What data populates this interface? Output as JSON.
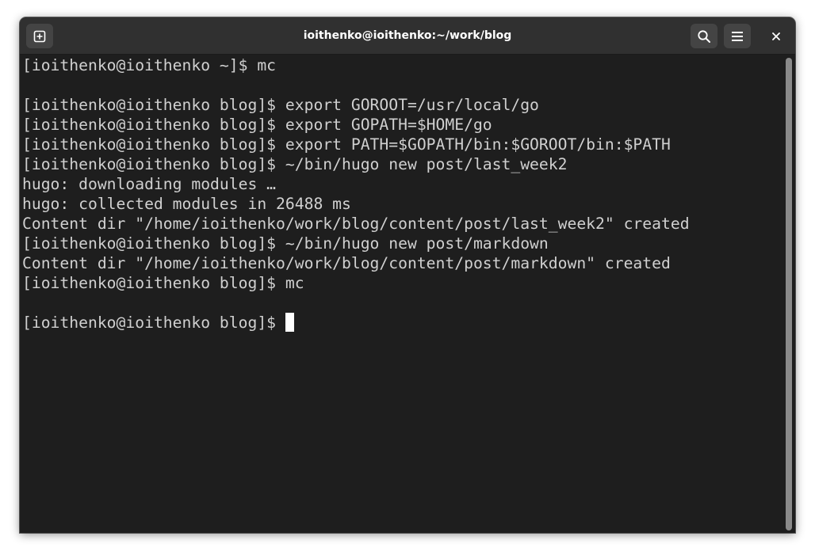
{
  "window": {
    "title": "ioithenko@ioithenko:~/work/blog"
  },
  "headerbar": {
    "new_tab_icon": "new-tab-icon",
    "search_icon": "search-icon",
    "menu_icon": "hamburger-menu-icon",
    "close_icon": "close-icon"
  },
  "terminal": {
    "lines": [
      "[ioithenko@ioithenko ~]$ mc",
      "",
      "[ioithenko@ioithenko blog]$ export GOROOT=/usr/local/go",
      "[ioithenko@ioithenko blog]$ export GOPATH=$HOME/go",
      "[ioithenko@ioithenko blog]$ export PATH=$GOPATH/bin:$GOROOT/bin:$PATH",
      "[ioithenko@ioithenko blog]$ ~/bin/hugo new post/last_week2",
      "hugo: downloading modules …",
      "hugo: collected modules in 26488 ms",
      "Content dir \"/home/ioithenko/work/blog/content/post/last_week2\" created",
      "[ioithenko@ioithenko blog]$ ~/bin/hugo new post/markdown",
      "Content dir \"/home/ioithenko/work/blog/content/post/markdown\" created",
      "[ioithenko@ioithenko blog]$ mc",
      "",
      "[ioithenko@ioithenko blog]$ "
    ]
  },
  "colors": {
    "background": "#1e1e1e",
    "headerbar": "#303030",
    "text": "#d0d0d0",
    "cursor": "#ffffff",
    "scrollbar": "#8a8a8a"
  }
}
